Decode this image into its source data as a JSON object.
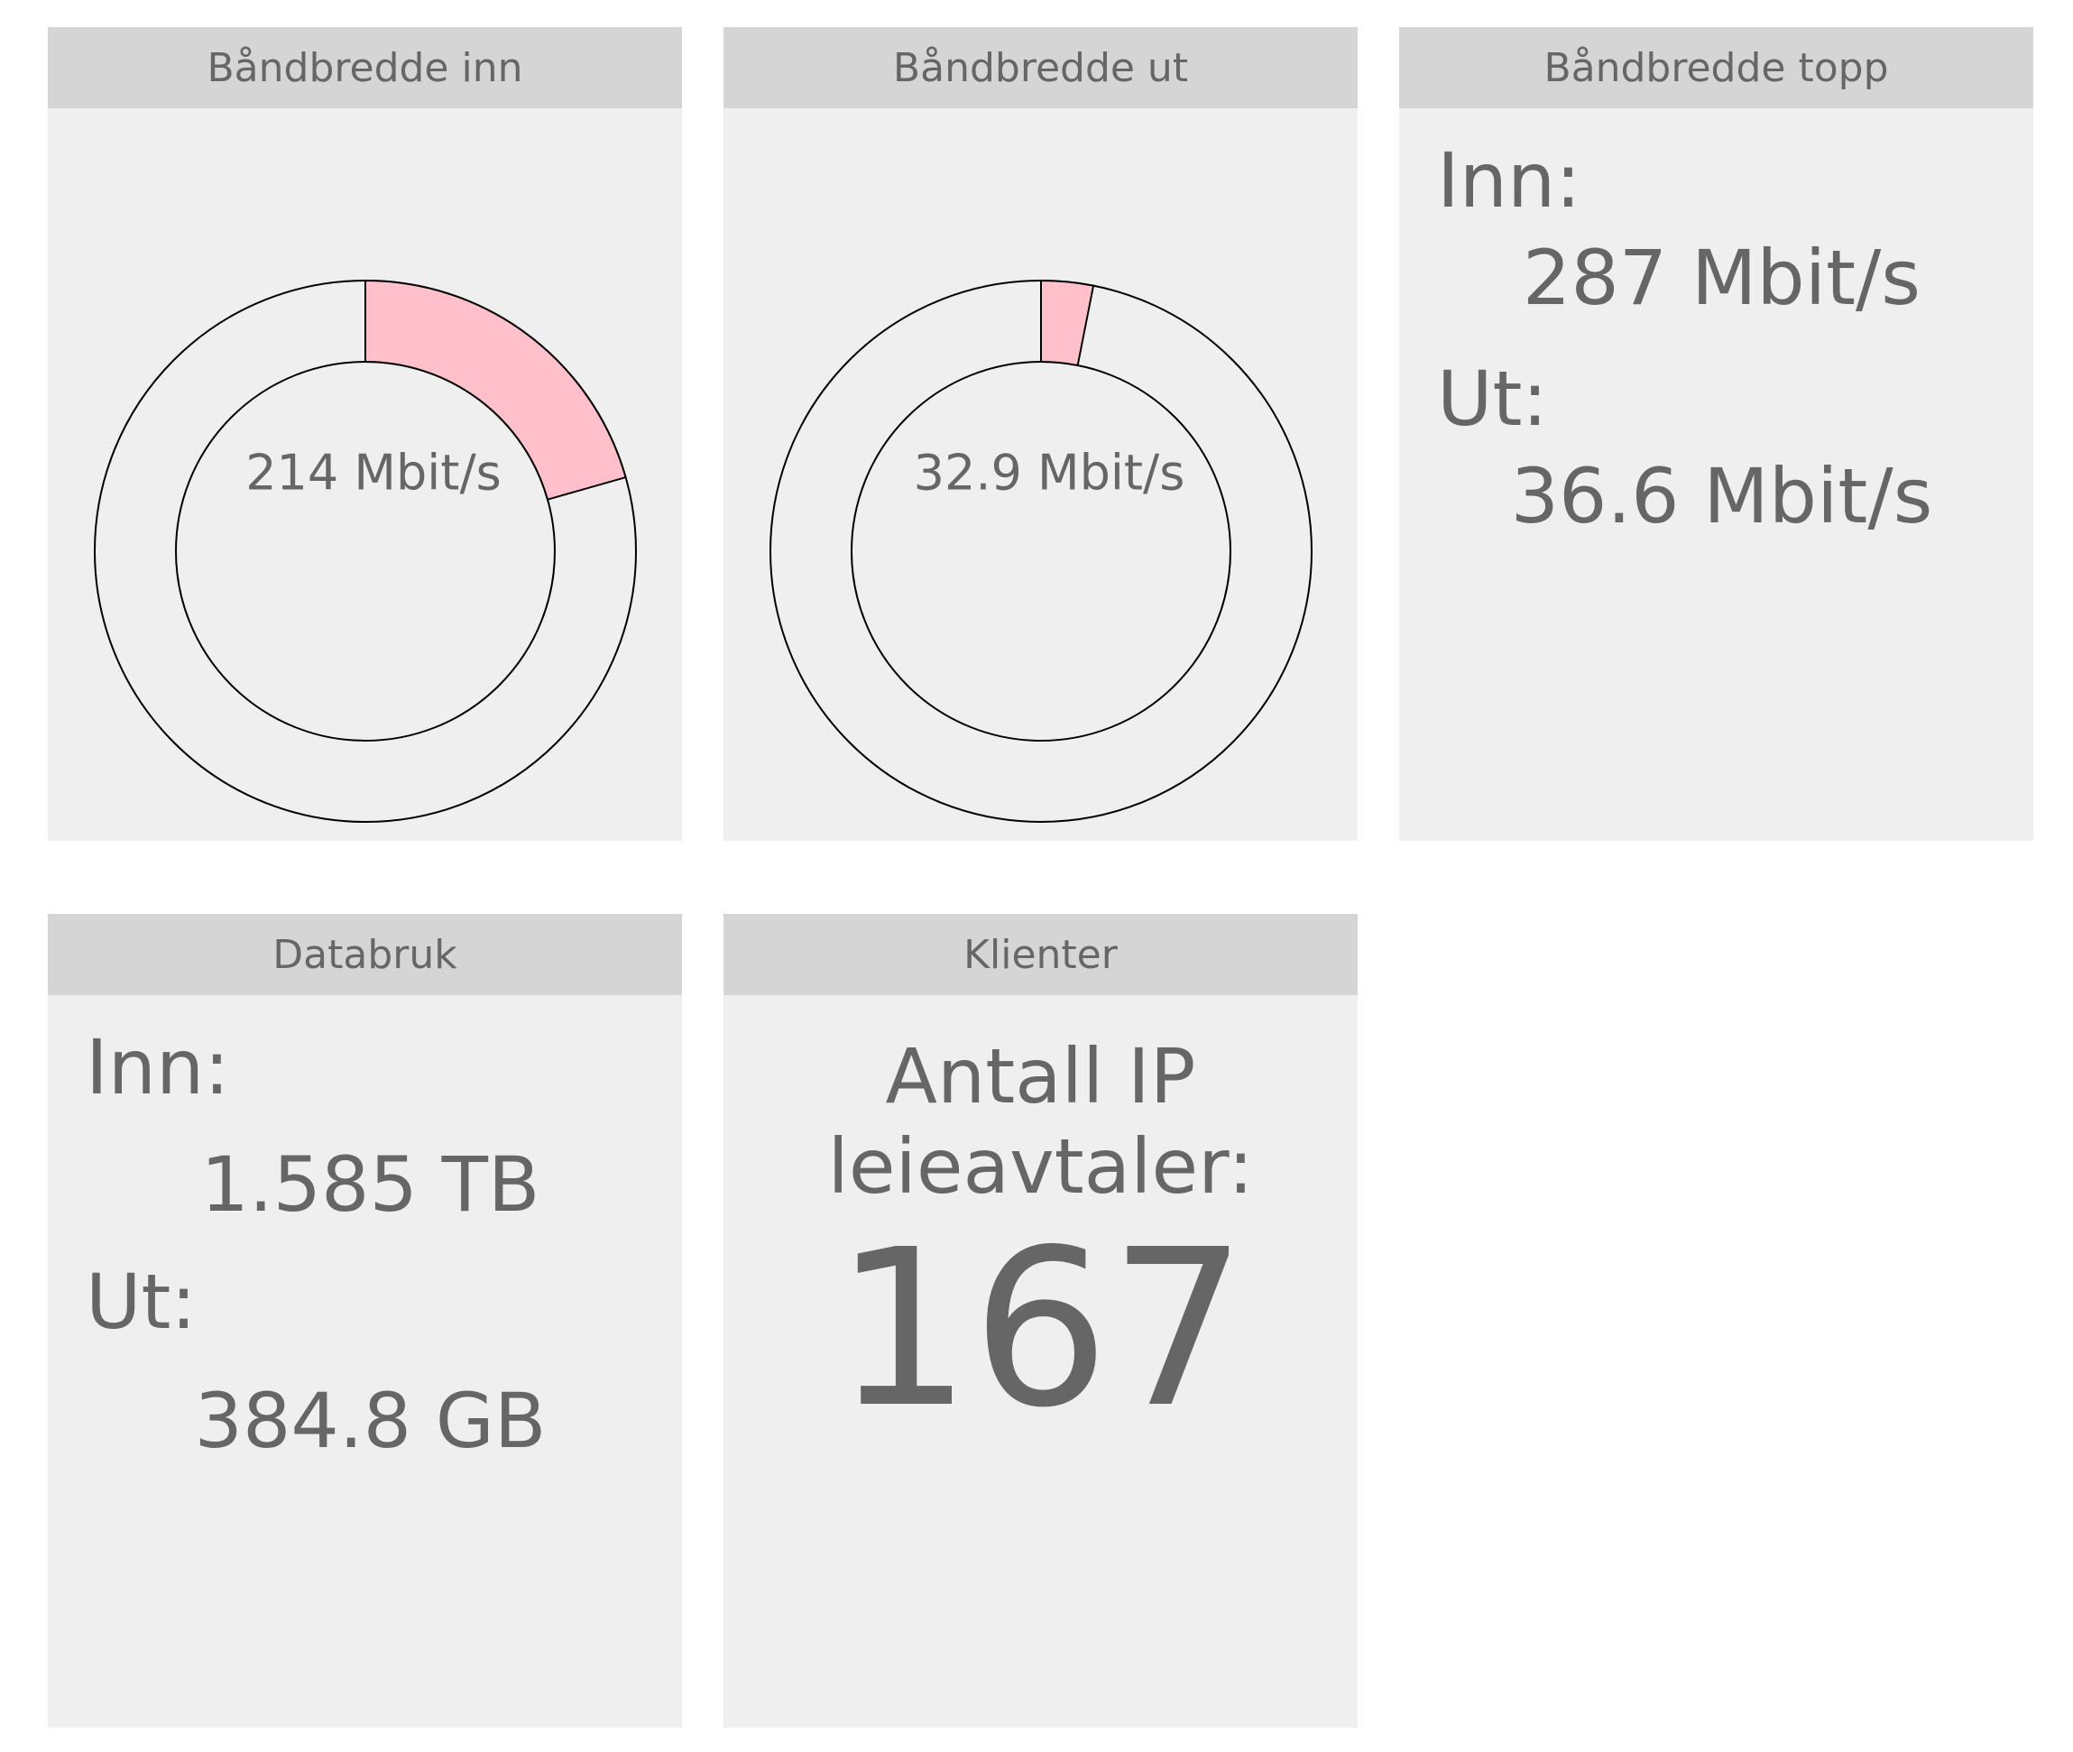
{
  "panels": {
    "bandwidth_in": {
      "title": "Båndbredde inn",
      "value_label": "214 Mbit/s",
      "fraction": 0.206
    },
    "bandwidth_out": {
      "title": "Båndbredde ut",
      "value_label": "32.9 Mbit/s",
      "fraction": 0.031
    },
    "bandwidth_peak": {
      "title": "Båndbredde topp",
      "in_label": "Inn:",
      "in_value": "287 Mbit/s",
      "out_label": "Ut:",
      "out_value": "36.6 Mbit/s"
    },
    "data_usage": {
      "title": "Databruk",
      "in_label": "Inn:",
      "in_value": "1.585 TB",
      "out_label": "Ut:",
      "out_value": "384.8 GB"
    },
    "clients": {
      "title": "Klienter",
      "label": "Antall IP leieavtaler:",
      "count": "167"
    }
  },
  "colors": {
    "gauge_fill": "#ffc0cb",
    "gauge_track": "#efefef",
    "gauge_stroke": "#000000",
    "header_bg": "#d5d5d5",
    "panel_bg": "#efefef",
    "text": "#666666"
  }
}
